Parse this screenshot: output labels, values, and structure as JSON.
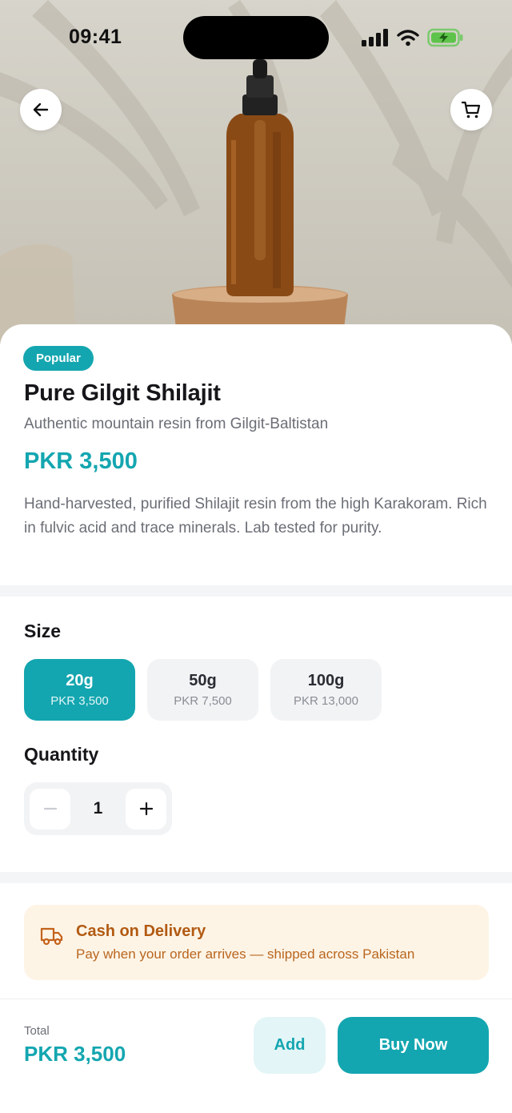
{
  "status_bar": {
    "time": "09:41"
  },
  "header": {
    "back_icon": "arrow-left-icon",
    "cart_icon": "shopping-cart-icon"
  },
  "product": {
    "badge": "Popular",
    "title": "Pure Gilgit Shilajit",
    "subtitle": "Authentic mountain resin from Gilgit-Baltistan",
    "price": "PKR 3,500",
    "description": "Hand-harvested, purified Shilajit resin from the high Karakoram. Rich in fulvic acid and trace minerals. Lab tested for purity."
  },
  "size": {
    "label": "Size",
    "options": [
      {
        "size": "20g",
        "price": "PKR 3,500",
        "selected": true
      },
      {
        "size": "50g",
        "price": "PKR 7,500",
        "selected": false
      },
      {
        "size": "100g",
        "price": "PKR 13,000",
        "selected": false
      }
    ]
  },
  "quantity": {
    "label": "Quantity",
    "value": "1",
    "decrement_icon": "minus-icon",
    "increment_icon": "plus-icon"
  },
  "delivery": {
    "icon": "truck-icon",
    "title": "Cash on Delivery",
    "text": "Pay when your order arrives — shipped across Pakistan"
  },
  "footer": {
    "total_label": "Total",
    "total_value": "PKR 3,500",
    "add_label": "Add",
    "buy_label": "Buy Now"
  },
  "colors": {
    "accent": "#14a6b0",
    "accent_light": "#e3f5f6",
    "cod_background": "#fdf4e6",
    "cod_text": "#b25a12"
  }
}
